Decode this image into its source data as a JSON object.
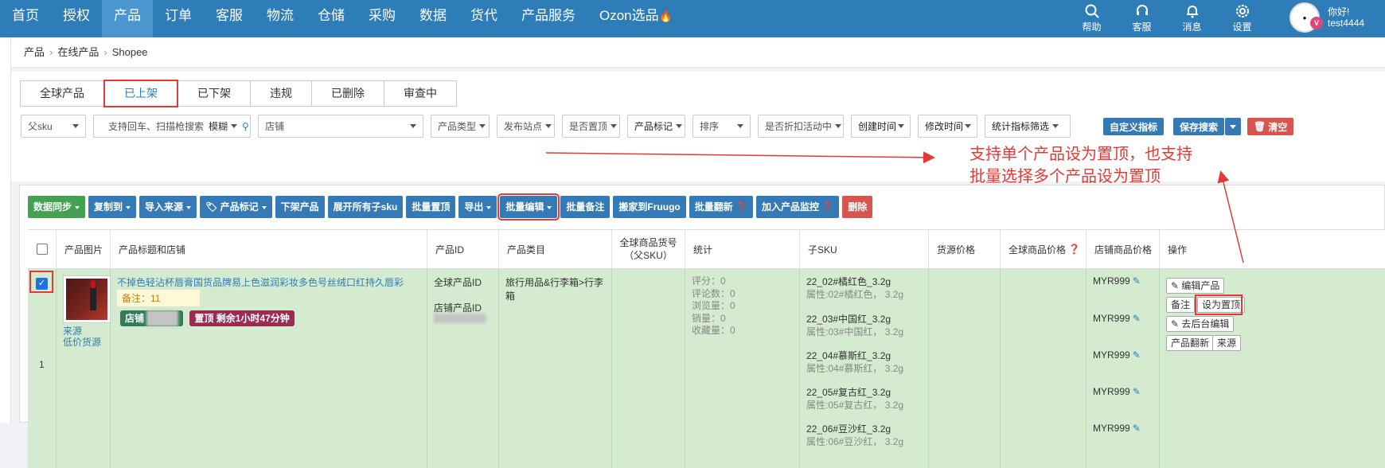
{
  "nav": {
    "items": [
      "首页",
      "授权",
      "产品",
      "订单",
      "客服",
      "物流",
      "仓储",
      "采购",
      "数据",
      "货代",
      "产品服务",
      "Ozon选品"
    ],
    "active_index": 2,
    "right": [
      {
        "label": "帮助",
        "icon": "search-icon"
      },
      {
        "label": "客服",
        "icon": "headset-icon"
      },
      {
        "label": "消息",
        "icon": "bell-icon"
      },
      {
        "label": "设置",
        "icon": "gear-icon"
      }
    ],
    "user": {
      "greeting": "你好!",
      "name": "test4444",
      "badge": "V"
    }
  },
  "breadcrumb": [
    "产品",
    "在线产品",
    "Shopee"
  ],
  "tabs": [
    "全球产品",
    "已上架",
    "已下架",
    "违规",
    "已删除",
    "审查中"
  ],
  "active_tab": 1,
  "filters": {
    "parent_sku": "父sku",
    "search_placeholder": "支持回车、扫描枪搜索",
    "search_mode": "模糊",
    "shop": "店铺",
    "product_type": "产品类型",
    "site": "发布站点",
    "pinned": "是否置顶",
    "product_mark": "产品标记",
    "sort": "排序",
    "discount": "是否折扣活动中",
    "created": "创建时间",
    "modified": "修改时间",
    "metric_filter": "统计指标筛选",
    "custom_metric": "自定义指标",
    "save_search": "保存搜索",
    "clear": "清空"
  },
  "toolbar": [
    {
      "label": "数据同步",
      "color": "green",
      "caret": true
    },
    {
      "label": "复制到",
      "color": "blue",
      "caret": true
    },
    {
      "label": "导入来源",
      "color": "blue",
      "caret": true
    },
    {
      "label": "产品标记",
      "color": "blue",
      "caret": true,
      "icon": "tag-icon"
    },
    {
      "label": "下架产品",
      "color": "blue"
    },
    {
      "label": "展开所有子sku",
      "color": "blue"
    },
    {
      "label": "批量置顶",
      "color": "blue"
    },
    {
      "label": "导出",
      "color": "blue",
      "caret": true
    },
    {
      "label": "批量编辑",
      "color": "blue",
      "caret": true,
      "highlight": true
    },
    {
      "label": "批量备注",
      "color": "blue"
    },
    {
      "label": "搬家到Fruugo",
      "color": "blue"
    },
    {
      "label": "批量翻新",
      "color": "blue",
      "icon": "question-icon"
    },
    {
      "label": "加入产品监控",
      "color": "blue",
      "icon": "question-icon"
    },
    {
      "label": "删除",
      "color": "red"
    }
  ],
  "annotation": "支持单个产品设为置顶，也支持批量选择多个产品设为置顶",
  "columns": [
    "产品图片",
    "产品标题和店铺",
    "产品ID",
    "产品类目",
    "全球商品货号（父SKU）",
    "统计",
    "子SKU",
    "货源价格",
    "全球商品价格",
    "店铺商品价格",
    "操作"
  ],
  "row": {
    "index": "1",
    "title": "不掉色轻沾杯唇膏国货品牌易上色滋润彩妆多色号丝绒口红持久唇彩",
    "remark": "备注：11",
    "shop_badge": "店铺",
    "pin_badge": "置顶",
    "pin_remaining": "剩余1小时47分钟",
    "source": "来源",
    "low_price_source": "低价货源",
    "global_id_label": "全球产品ID",
    "shop_id_label": "店铺产品ID",
    "category": "旅行用品&行李箱>行李箱",
    "stats": [
      "评分：0",
      "评论数：0",
      "浏览量：0",
      "销量：0",
      "收藏量：0"
    ],
    "skus": [
      {
        "sku": "22_02#橘红色_3.2g",
        "attr": "属性:02#橘红色， 3.2g",
        "price": "MYR999"
      },
      {
        "sku": "22_03#中国红_3.2g",
        "attr": "属性:03#中国红， 3.2g",
        "price": "MYR999"
      },
      {
        "sku": "22_04#慕斯红_3.2g",
        "attr": "属性:04#慕斯红， 3.2g",
        "price": "MYR999"
      },
      {
        "sku": "22_05#复古红_3.2g",
        "attr": "属性:05#复古红， 3.2g",
        "price": "MYR999"
      },
      {
        "sku": "22_06#豆沙红_3.2g",
        "attr": "属性:06#豆沙红， 3.2g",
        "price": "MYR999"
      }
    ],
    "ops": {
      "edit": "编辑产品",
      "remark": "备注",
      "pin": "设为置顶",
      "backend": "去后台编辑",
      "renew": "产品翻新",
      "source": "来源"
    }
  },
  "colors": {
    "nav": "#2e7db8",
    "row_bg": "#d4ebcf",
    "highlight": "#e53935",
    "blue_btn": "#337ab7",
    "green_btn": "#45a152",
    "red_btn": "#d9534f"
  }
}
